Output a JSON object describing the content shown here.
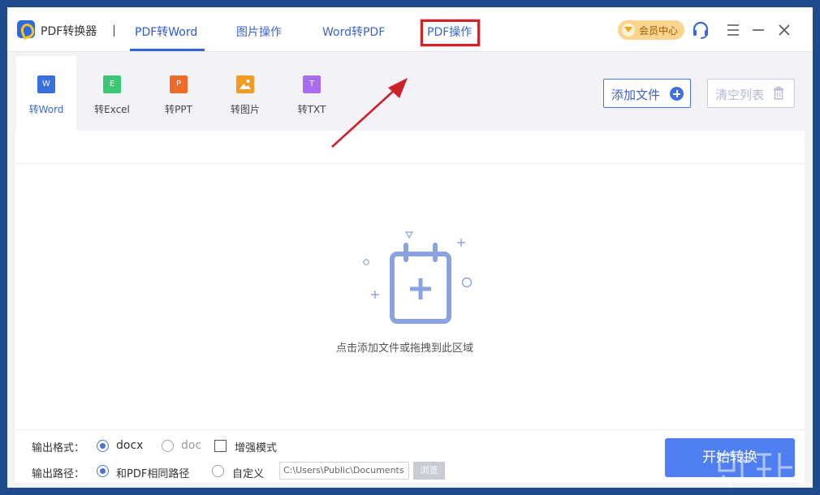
{
  "app": {
    "name": "PDF转换器"
  },
  "nav": {
    "tabs": [
      {
        "label": "PDF转Word"
      },
      {
        "label": "图片操作"
      },
      {
        "label": "Word转PDF"
      },
      {
        "label": "PDF操作"
      }
    ]
  },
  "vip": {
    "label": "会员中心"
  },
  "types": [
    {
      "label": "转Word",
      "glyph": "W",
      "color": "#3a6fe0"
    },
    {
      "label": "转Excel",
      "glyph": "E",
      "color": "#3cc774"
    },
    {
      "label": "转PPT",
      "glyph": "P",
      "color": "#f06b2a"
    },
    {
      "label": "转图片",
      "glyph": "",
      "color": "#f39a22"
    },
    {
      "label": "转TXT",
      "glyph": "T",
      "color": "#a96cf0"
    }
  ],
  "toolbar": {
    "add_label": "添加文件",
    "clear_label": "清空列表"
  },
  "drop": {
    "hint": "点击添加文件或拖拽到此区域"
  },
  "output": {
    "format_label": "输出格式：",
    "format_options": [
      "docx",
      "doc"
    ],
    "enhanced_label": "增强模式",
    "path_label": "输出路径：",
    "path_same": "和PDF相同路径",
    "path_custom": "自定义",
    "path_value": "C:\\Users\\Public\\Documents",
    "browse_label": "浏览"
  },
  "start_label": "开始转换"
}
